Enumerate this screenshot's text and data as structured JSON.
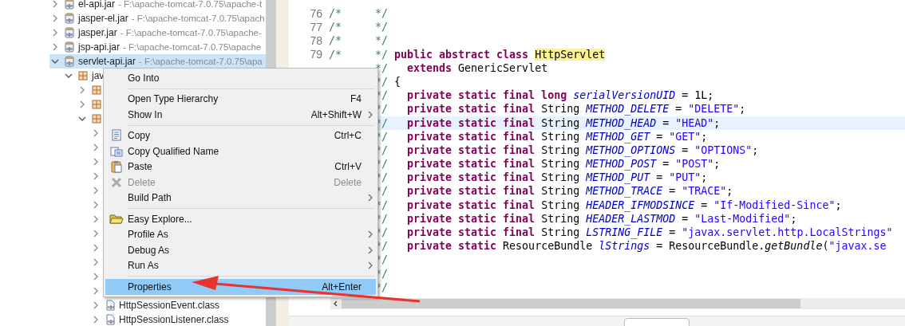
{
  "tree": [
    {
      "kind": "jar",
      "label": "el-api.jar",
      "detail": "- F:\\apache-tomcat-7.0.75\\apache-t",
      "expanded": false,
      "selected": false
    },
    {
      "kind": "jar",
      "label": "jasper-el.jar",
      "detail": "- F:\\apache-tomcat-7.0.75\\apach",
      "expanded": false,
      "selected": false
    },
    {
      "kind": "jar",
      "label": "jasper.jar",
      "detail": "- F:\\apache-tomcat-7.0.75\\apache-",
      "expanded": false,
      "selected": false
    },
    {
      "kind": "jar",
      "label": "jsp-api.jar",
      "detail": "- F:\\apache-tomcat-7.0.75\\apache",
      "expanded": false,
      "selected": false
    },
    {
      "kind": "jar",
      "label": "servlet-api.jar",
      "detail": "- F:\\apache-tomcat-7.0.75\\apa",
      "expanded": true,
      "selected": true,
      "children": [
        {
          "kind": "package",
          "label": "jav",
          "expanded": true,
          "selected": false,
          "children": [
            {
              "kind": "package",
              "expanded": false,
              "selected": false
            },
            {
              "kind": "package",
              "expanded": false,
              "selected": false
            },
            {
              "kind": "package",
              "expanded": true,
              "selected": false,
              "children": [
                {
                  "expanded": false,
                  "selected": false
                },
                {
                  "expanded": false,
                  "selected": false
                },
                {
                  "expanded": false,
                  "selected": false
                },
                {
                  "expanded": false,
                  "selected": false
                },
                {
                  "expanded": false,
                  "selected": false
                },
                {
                  "expanded": false,
                  "selected": false
                },
                {
                  "expanded": false,
                  "selected": false
                },
                {
                  "expanded": false,
                  "selected": false
                },
                {
                  "expanded": false,
                  "selected": false
                },
                {
                  "expanded": false,
                  "selected": false
                },
                {
                  "expanded": false,
                  "selected": false
                },
                {
                  "expanded": false,
                  "selected": false
                },
                {
                  "kind": "class",
                  "label": "HttpSessionEvent.class",
                  "expanded": false,
                  "selected": false
                },
                {
                  "kind": "class",
                  "label": "HttpSessionListener.class",
                  "expanded": false,
                  "selected": false
                }
              ]
            }
          ]
        }
      ]
    }
  ],
  "context_menu": [
    {
      "kind": "item",
      "label": "Go Into",
      "submenu": false,
      "disabled": false,
      "selected": false
    },
    {
      "kind": "separator"
    },
    {
      "kind": "item",
      "label": "Open Type Hierarchy",
      "shortcut": "F4",
      "submenu": false,
      "disabled": false,
      "selected": false
    },
    {
      "kind": "item",
      "label": "Show In",
      "shortcut": "Alt+Shift+W",
      "submenu": true,
      "disabled": false,
      "selected": false
    },
    {
      "kind": "separator"
    },
    {
      "kind": "item",
      "label": "Copy",
      "shortcut": "Ctrl+C",
      "submenu": false,
      "disabled": false,
      "selected": false
    },
    {
      "kind": "item",
      "label": "Copy Qualified Name",
      "submenu": false,
      "disabled": false,
      "selected": false
    },
    {
      "kind": "item",
      "label": "Paste",
      "shortcut": "Ctrl+V",
      "submenu": false,
      "disabled": false,
      "selected": false
    },
    {
      "kind": "item",
      "label": "Delete",
      "shortcut": "Delete",
      "submenu": false,
      "disabled": true,
      "selected": false
    },
    {
      "kind": "item",
      "label": "Build Path",
      "submenu": true,
      "disabled": false,
      "selected": false
    },
    {
      "kind": "separator"
    },
    {
      "kind": "item",
      "label": "Easy Explore...",
      "submenu": false,
      "disabled": false,
      "selected": false
    },
    {
      "kind": "item",
      "label": "Profile As",
      "submenu": true,
      "disabled": false,
      "selected": false
    },
    {
      "kind": "item",
      "label": "Debug As",
      "submenu": true,
      "disabled": false,
      "selected": false
    },
    {
      "kind": "item",
      "label": "Run As",
      "submenu": true,
      "disabled": false,
      "selected": false
    },
    {
      "kind": "separator"
    },
    {
      "kind": "item",
      "label": "Properties",
      "shortcut": "Alt+Enter",
      "submenu": false,
      "disabled": false,
      "selected": true
    }
  ],
  "editor": {
    "lines": [
      {
        "number": "76",
        "open": "/*",
        "close": "*/",
        "current": false
      },
      {
        "number": "77",
        "open": "/*",
        "close": "*/",
        "current": false
      },
      {
        "number": "78",
        "open": "/*",
        "close": "*/",
        "current": false
      },
      {
        "number": "79",
        "open": "/*",
        "close": "*/",
        "current": false,
        "segments": [
          {
            "kind": "keyword",
            "text": "public abstract class "
          },
          {
            "kind": "highlight",
            "text": "HttpServlet"
          }
        ]
      },
      {
        "close": "*/",
        "current": false,
        "segments": [
          {
            "kind": "keyword",
            "text": "  extends"
          },
          {
            "kind": "plain",
            "text": " GenericServlet"
          }
        ]
      },
      {
        "close": "*/",
        "current": false,
        "segments": [
          {
            "kind": "plain",
            "text": "{"
          }
        ]
      },
      {
        "close": "*/",
        "current": false,
        "segments": [
          {
            "kind": "keyword",
            "text": "  private static final long "
          },
          {
            "kind": "field",
            "text": "serialVersionUID"
          },
          {
            "kind": "plain",
            "text": " = 1L;"
          }
        ]
      },
      {
        "close": "*/",
        "current": false,
        "segments": [
          {
            "kind": "keyword",
            "text": "  private static final"
          },
          {
            "kind": "plain",
            "text": " String "
          },
          {
            "kind": "field",
            "text": "METHOD_DELETE"
          },
          {
            "kind": "plain",
            "text": " = "
          },
          {
            "kind": "string",
            "text": "\"DELETE\""
          },
          {
            "kind": "plain",
            "text": ";"
          }
        ]
      },
      {
        "close": "*/",
        "current": true,
        "segments": [
          {
            "kind": "keyword",
            "text": "  private static final"
          },
          {
            "kind": "plain",
            "text": " String "
          },
          {
            "kind": "field",
            "text": "METHOD_HEAD"
          },
          {
            "kind": "plain",
            "text": " = "
          },
          {
            "kind": "string",
            "text": "\"HEAD\""
          },
          {
            "kind": "plain",
            "text": ";"
          }
        ]
      },
      {
        "close": "*/",
        "current": false,
        "segments": [
          {
            "kind": "keyword",
            "text": "  private static final"
          },
          {
            "kind": "plain",
            "text": " String "
          },
          {
            "kind": "field",
            "text": "METHOD_GET"
          },
          {
            "kind": "plain",
            "text": " = "
          },
          {
            "kind": "string",
            "text": "\"GET\""
          },
          {
            "kind": "plain",
            "text": ";"
          }
        ]
      },
      {
        "close": "*/",
        "current": false,
        "segments": [
          {
            "kind": "keyword",
            "text": "  private static final"
          },
          {
            "kind": "plain",
            "text": " String "
          },
          {
            "kind": "field",
            "text": "METHOD_OPTIONS"
          },
          {
            "kind": "plain",
            "text": " = "
          },
          {
            "kind": "string",
            "text": "\"OPTIONS\""
          },
          {
            "kind": "plain",
            "text": ";"
          }
        ]
      },
      {
        "close": "*/",
        "current": false,
        "segments": [
          {
            "kind": "keyword",
            "text": "  private static final"
          },
          {
            "kind": "plain",
            "text": " String "
          },
          {
            "kind": "field",
            "text": "METHOD_POST"
          },
          {
            "kind": "plain",
            "text": " = "
          },
          {
            "kind": "string",
            "text": "\"POST\""
          },
          {
            "kind": "plain",
            "text": ";"
          }
        ]
      },
      {
        "close": "*/",
        "current": false,
        "segments": [
          {
            "kind": "keyword",
            "text": "  private static final"
          },
          {
            "kind": "plain",
            "text": " String "
          },
          {
            "kind": "field",
            "text": "METHOD_PUT"
          },
          {
            "kind": "plain",
            "text": " = "
          },
          {
            "kind": "string",
            "text": "\"PUT\""
          },
          {
            "kind": "plain",
            "text": ";"
          }
        ]
      },
      {
        "close": "*/",
        "current": false,
        "segments": [
          {
            "kind": "keyword",
            "text": "  private static final"
          },
          {
            "kind": "plain",
            "text": " String "
          },
          {
            "kind": "field",
            "text": "METHOD_TRACE"
          },
          {
            "kind": "plain",
            "text": " = "
          },
          {
            "kind": "string",
            "text": "\"TRACE\""
          },
          {
            "kind": "plain",
            "text": ";"
          }
        ]
      },
      {
        "close": "*/",
        "current": false,
        "segments": [
          {
            "kind": "keyword",
            "text": "  private static final"
          },
          {
            "kind": "plain",
            "text": " String "
          },
          {
            "kind": "field",
            "text": "HEADER_IFMODSINCE"
          },
          {
            "kind": "plain",
            "text": " = "
          },
          {
            "kind": "string",
            "text": "\"If-Modified-Since\""
          },
          {
            "kind": "plain",
            "text": ";"
          }
        ]
      },
      {
        "close": "*/",
        "current": false,
        "segments": [
          {
            "kind": "keyword",
            "text": "  private static final"
          },
          {
            "kind": "plain",
            "text": " String "
          },
          {
            "kind": "field",
            "text": "HEADER_LASTMOD"
          },
          {
            "kind": "plain",
            "text": " = "
          },
          {
            "kind": "string",
            "text": "\"Last-Modified\""
          },
          {
            "kind": "plain",
            "text": ";"
          }
        ]
      },
      {
        "close": "*/",
        "current": false,
        "segments": [
          {
            "kind": "keyword",
            "text": "  private static final"
          },
          {
            "kind": "plain",
            "text": " String "
          },
          {
            "kind": "field",
            "text": "LSTRING_FILE"
          },
          {
            "kind": "plain",
            "text": " = "
          },
          {
            "kind": "string",
            "text": "\"javax.servlet.http.LocalStrings\""
          }
        ]
      },
      {
        "close": "*/",
        "current": false,
        "segments": [
          {
            "kind": "keyword",
            "text": "  private static"
          },
          {
            "kind": "plain",
            "text": " ResourceBundle "
          },
          {
            "kind": "field",
            "text": "lStrings"
          },
          {
            "kind": "plain",
            "text": " = ResourceBundle."
          },
          {
            "kind": "method",
            "text": "getBundle"
          },
          {
            "kind": "plain",
            "text": "("
          },
          {
            "kind": "string",
            "text": "\"javax.se"
          }
        ]
      },
      {
        "close": "*/",
        "current": false
      },
      {
        "close": "*/",
        "current": false
      },
      {
        "close": "*/",
        "current": false
      }
    ]
  }
}
